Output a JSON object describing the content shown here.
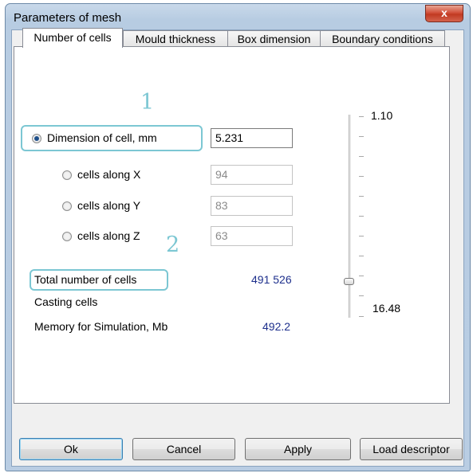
{
  "window": {
    "title": "Parameters of mesh",
    "close_label": "x"
  },
  "tabs": [
    {
      "label": "Number of cells"
    },
    {
      "label": "Mould thickness"
    },
    {
      "label": "Box dimension"
    },
    {
      "label": "Boundary conditions"
    }
  ],
  "annotations": {
    "one": "1",
    "two": "2"
  },
  "cell": {
    "dimension_label": "Dimension of cell, mm",
    "dimension_value": "5.231",
    "along_x_label": "cells along X",
    "along_x_value": "94",
    "along_y_label": "cells along Y",
    "along_y_value": "83",
    "along_z_label": "cells along Z",
    "along_z_value": "63"
  },
  "totals": {
    "total_label": "Total number of cells",
    "total_value": "491 526",
    "casting_label": "Casting cells",
    "memory_label": "Memory for Simulation, Mb",
    "memory_value": "492.2"
  },
  "slider": {
    "max_label": "1.10",
    "min_label": "16.48"
  },
  "buttons": {
    "ok": "Ok",
    "cancel": "Cancel",
    "apply": "Apply",
    "load": "Load descriptor"
  },
  "colors": {
    "annotation": "#7cc7d3",
    "value_blue": "#1d2f8c"
  }
}
